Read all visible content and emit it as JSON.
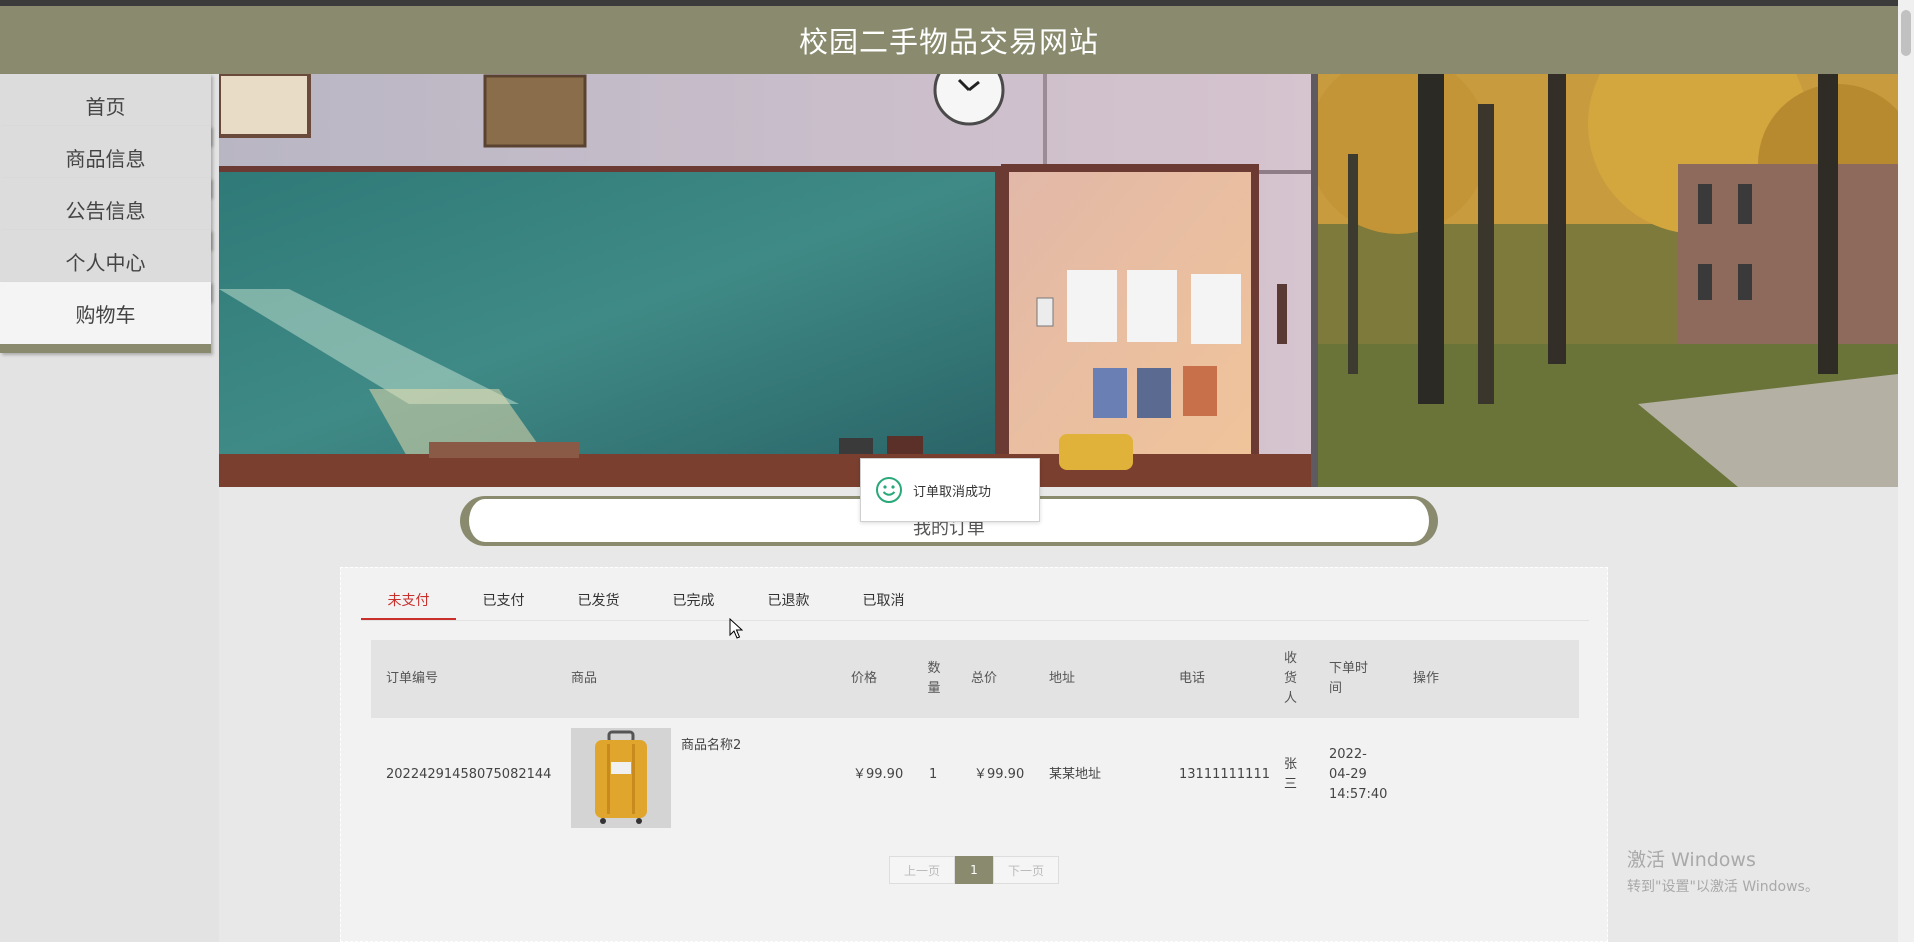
{
  "site_title": "校园二手物品交易网站",
  "nav": {
    "home": "首页",
    "goods": "商品信息",
    "notice": "公告信息",
    "profile": "个人中心",
    "cart": "购物车"
  },
  "page_heading": "我的订单",
  "tabs": [
    "未支付",
    "已支付",
    "已发货",
    "已完成",
    "已退款",
    "已取消"
  ],
  "active_tab": "未支付",
  "table": {
    "headers": {
      "order_no": "订单编号",
      "goods": "商品",
      "price": "价格",
      "qty": "数量",
      "total": "总价",
      "address": "地址",
      "phone": "电话",
      "receiver": "收货人",
      "time": "下单时间",
      "action": "操作"
    },
    "rows": [
      {
        "order_no": "20224291458075082144",
        "goods_name": "商品名称2",
        "price": "￥99.90",
        "qty": "1",
        "total": "￥99.90",
        "address": "某某地址",
        "phone": "13111111111",
        "receiver": "张三",
        "time": "2022-04-29 14:57:40"
      }
    ]
  },
  "pagination": {
    "prev": "上一页",
    "current": "1",
    "next": "下一页"
  },
  "toast": {
    "message": "订单取消成功"
  },
  "watermark": {
    "line1": "激活 Windows",
    "line2": "转到\"设置\"以激活 Windows。"
  },
  "colors": {
    "theme": "#8a8b6e",
    "active_tab": "#c9302c",
    "toast_icon": "#2aa87a"
  }
}
